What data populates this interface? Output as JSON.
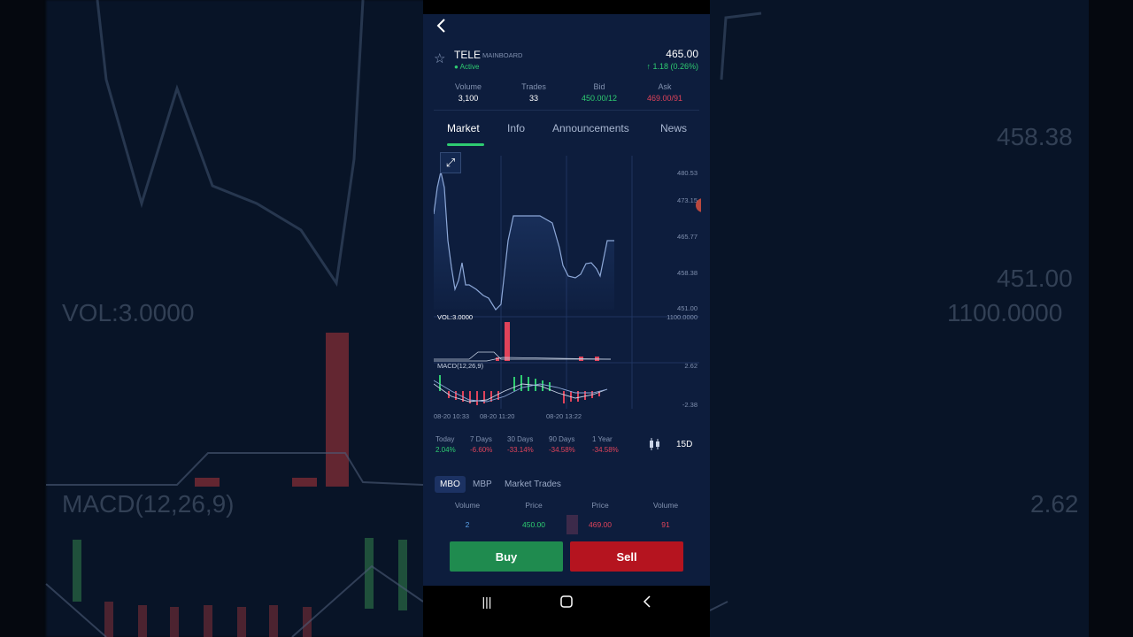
{
  "header": {
    "symbol": "TELE",
    "board": "MAINBOARD",
    "status": "Active",
    "price": "465.00",
    "change": "1.18 (0.26%)"
  },
  "stats": [
    {
      "label": "Volume",
      "value": "3,100"
    },
    {
      "label": "Trades",
      "value": "33"
    },
    {
      "label": "Bid",
      "value": "450.00/12"
    },
    {
      "label": "Ask",
      "value": "469.00/91"
    }
  ],
  "tabs": [
    "Market",
    "Info",
    "Announcements",
    "News"
  ],
  "chart": {
    "price_ticks": [
      "480.53",
      "473.15",
      "465.77",
      "458.38",
      "451.00"
    ],
    "vol_label": "VOL:3.0000",
    "vol_max": "1100.0000",
    "macd_label": "MACD(12,26,9)",
    "macd_top": "2.62",
    "macd_bottom": "-2.38",
    "time_labels": [
      "08-20 10:33",
      "08-20 11:20",
      "08-20 13:22"
    ]
  },
  "periods": [
    {
      "label": "Today",
      "value": "2.04%",
      "positive": true
    },
    {
      "label": "7 Days",
      "value": "-6.60%",
      "positive": false
    },
    {
      "label": "30 Days",
      "value": "-33.14%",
      "positive": false
    },
    {
      "label": "90 Days",
      "value": "-34.58%",
      "positive": false
    },
    {
      "label": "1 Year",
      "value": "-34.58%",
      "positive": false
    }
  ],
  "range": "15D",
  "subtabs": [
    "MBO",
    "MBP",
    "Market Trades"
  ],
  "orderbook": {
    "headers": [
      "Volume",
      "Price",
      "Price",
      "Volume"
    ],
    "row": [
      "2",
      "450.00",
      "469.00",
      "91"
    ]
  },
  "buttons": {
    "buy": "Buy",
    "sell": "Sell"
  },
  "backdrop": {
    "left_text": [
      "VOL:3.0000",
      "MACD(12,26,9)"
    ],
    "right_text": [
      "458.38",
      "451.00",
      "1100.0000",
      "2.62"
    ]
  },
  "colors": {
    "up": "#2ecc71",
    "down": "#e0435a",
    "bg": "#0d1d3d"
  }
}
